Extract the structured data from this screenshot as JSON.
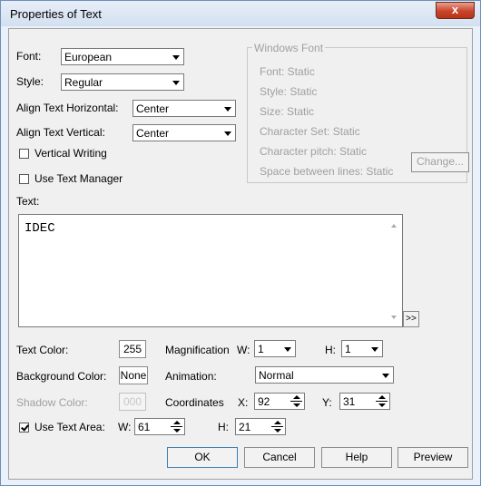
{
  "window": {
    "title": "Properties of Text",
    "close_glyph": "x"
  },
  "font": {
    "label": "Font:",
    "value": "European"
  },
  "style": {
    "label": "Style:",
    "value": "Regular"
  },
  "align_h": {
    "label": "Align Text Horizontal:",
    "value": "Center"
  },
  "align_v": {
    "label": "Align Text Vertical:",
    "value": "Center"
  },
  "vertical_writing": {
    "label": "Vertical Writing",
    "checked": false
  },
  "use_text_manager": {
    "label": "Use Text Manager",
    "checked": false
  },
  "windows_font": {
    "title": "Windows Font",
    "font": "Font:  Static",
    "style": "Style:   Static",
    "size": "Size:   Static",
    "charset": "Character Set:  Static",
    "pitch": "Character pitch:  Static",
    "spacing": "Space between lines:  Static",
    "change_button": "Change..."
  },
  "text": {
    "label": "Text:",
    "value": "IDEC",
    "expand_button": ">>"
  },
  "text_color": {
    "label": "Text Color:",
    "value": "255"
  },
  "background_color": {
    "label": "Background Color:",
    "value": "None"
  },
  "shadow_color": {
    "label": "Shadow Color:",
    "value": "000"
  },
  "magnification": {
    "label": "Magnification",
    "w_label": "W:",
    "w_value": "1",
    "h_label": "H:",
    "h_value": "1"
  },
  "animation": {
    "label": "Animation:",
    "value": "Normal"
  },
  "coordinates": {
    "label": "Coordinates",
    "x_label": "X:",
    "x_value": "92",
    "y_label": "Y:",
    "y_value": "31"
  },
  "text_area": {
    "label": "Use Text Area:",
    "checked": true,
    "w_label": "W:",
    "w_value": "61",
    "h_label": "H:",
    "h_value": "21"
  },
  "buttons": {
    "ok": "OK",
    "cancel": "Cancel",
    "help": "Help",
    "preview": "Preview"
  }
}
